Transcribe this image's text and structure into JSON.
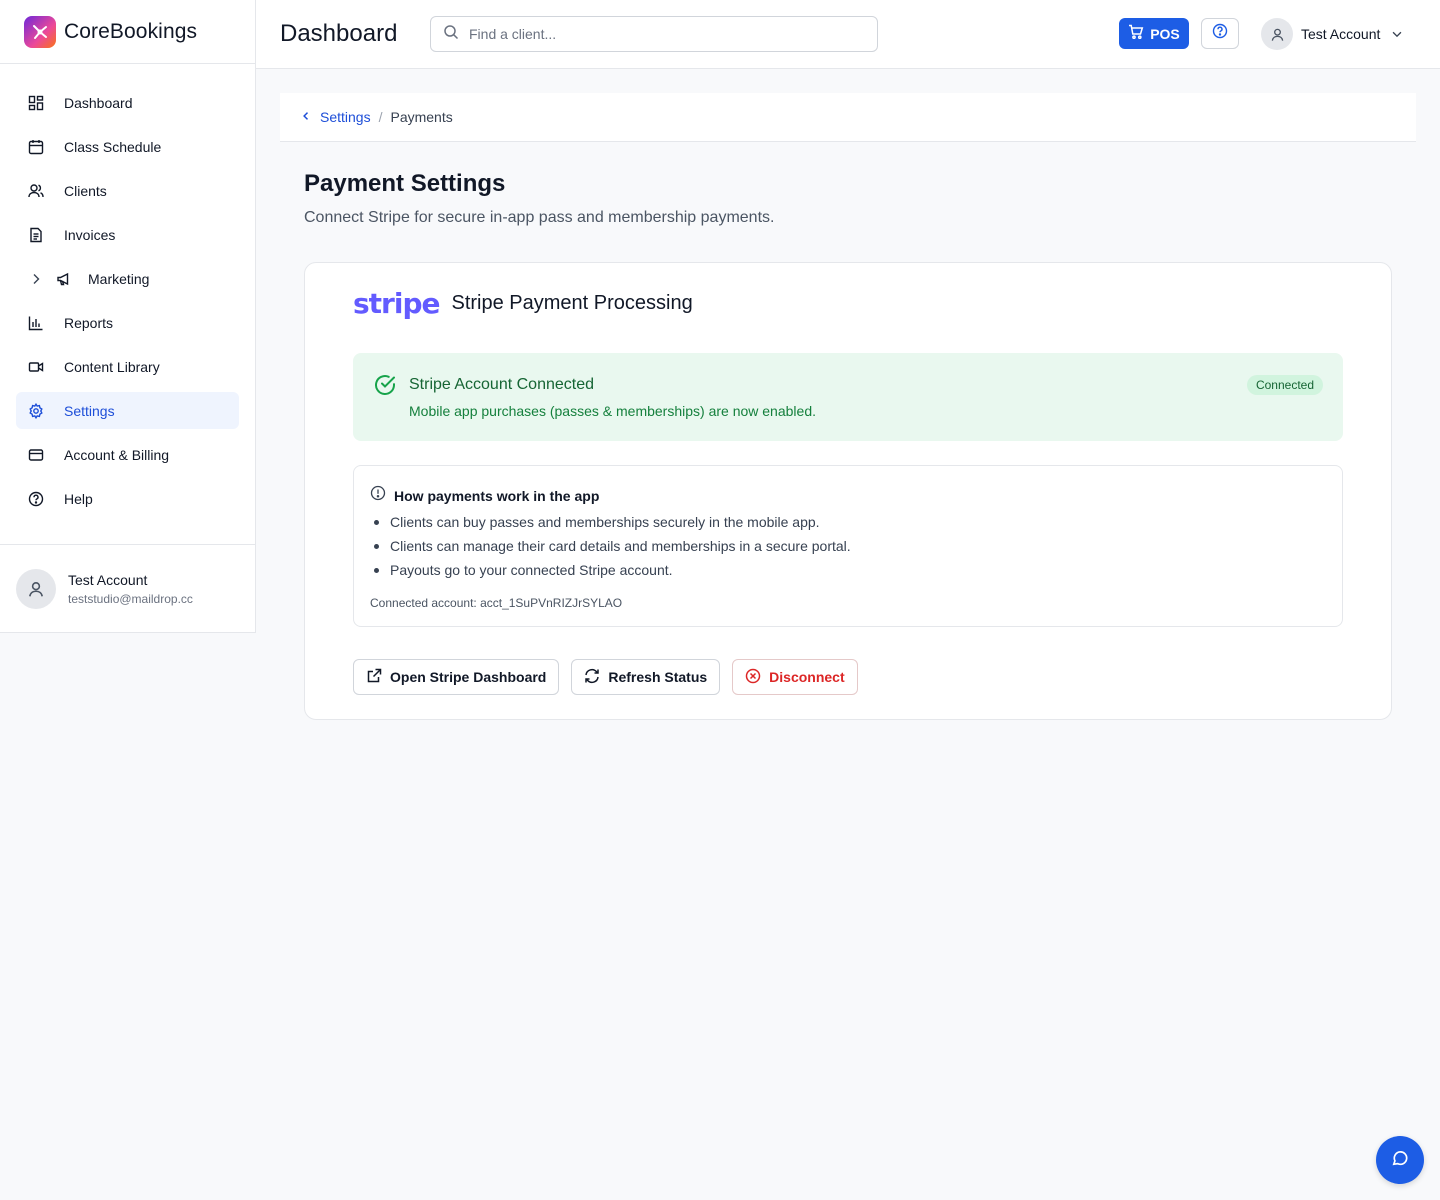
{
  "brand": {
    "name": "CoreBookings"
  },
  "sidebar": {
    "items": [
      {
        "label": "Dashboard",
        "icon": "dashboard-grid-icon"
      },
      {
        "label": "Class Schedule",
        "icon": "calendar-icon"
      },
      {
        "label": "Clients",
        "icon": "users-icon"
      },
      {
        "label": "Invoices",
        "icon": "document-icon"
      },
      {
        "label": "Marketing",
        "icon": "megaphone-icon"
      },
      {
        "label": "Reports",
        "icon": "bar-chart-icon"
      },
      {
        "label": "Content Library",
        "icon": "video-icon"
      },
      {
        "label": "Settings",
        "icon": "gear-icon",
        "active": true
      },
      {
        "label": "Account & Billing",
        "icon": "credit-card-icon"
      },
      {
        "label": "Help",
        "icon": "help-circle-icon"
      }
    ],
    "user": {
      "name": "Test Account",
      "email": "teststudio@maildrop.cc"
    }
  },
  "header": {
    "title": "Dashboard",
    "search_placeholder": "Find a client...",
    "pos_label": "POS",
    "account_name": "Test Account"
  },
  "breadcrumb": {
    "parent": "Settings",
    "separator": "/",
    "current": "Payments"
  },
  "page": {
    "title": "Payment Settings",
    "subtitle": "Connect Stripe for secure in-app pass and membership payments."
  },
  "card": {
    "logo_text": "stripe",
    "title": "Stripe Payment Processing",
    "status": {
      "title": "Stripe Account Connected",
      "description": "Mobile app purchases (passes & memberships) are now enabled.",
      "badge": "Connected"
    },
    "info": {
      "title": "How payments work in the app",
      "bullets": [
        "Clients can buy passes and memberships securely in the mobile app.",
        "Clients can manage their card details and memberships in a secure portal.",
        "Payouts go to your connected Stripe account."
      ],
      "account_line": "Connected account: acct_1SuPVnRIZJrSYLAO"
    },
    "actions": {
      "open_dashboard": "Open Stripe Dashboard",
      "refresh": "Refresh Status",
      "disconnect": "Disconnect"
    }
  },
  "colors": {
    "accent": "#1d5de5",
    "active_nav_bg": "#eff4fe",
    "success_bg": "#e9f8ef",
    "success_text": "#166534",
    "danger": "#dc2626",
    "stripe_brand": "#635bff"
  }
}
